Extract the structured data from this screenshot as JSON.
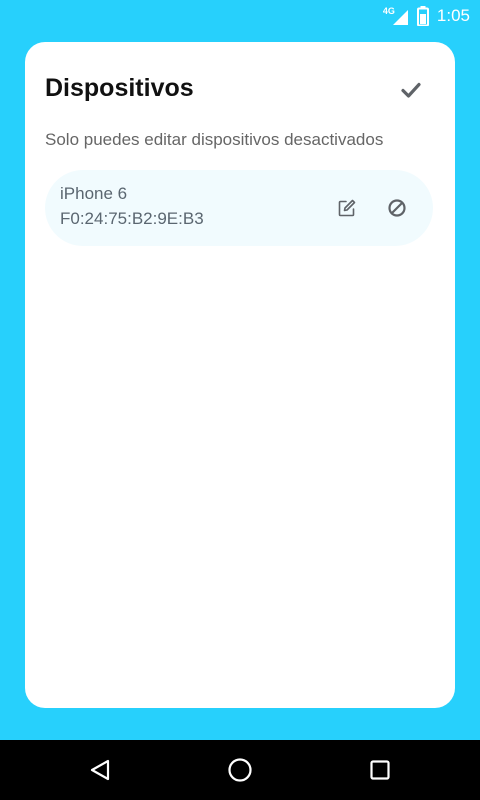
{
  "status_bar": {
    "network_label": "4G",
    "time": "1:05",
    "icons": [
      "signal-icon",
      "battery-icon"
    ]
  },
  "card": {
    "title": "Dispositivos",
    "subtitle": "Solo puedes editar dispositivos desactivados",
    "confirm_icon": "check-icon"
  },
  "devices": [
    {
      "name": "iPhone 6",
      "mac": "F0:24:75:B2:9E:B3",
      "edit_icon": "edit-icon",
      "deactivate_icon": "block-icon"
    }
  ],
  "nav_bar": {
    "icons": [
      "back-icon",
      "home-icon",
      "recents-icon"
    ]
  },
  "colors": {
    "background": "#27d0fc",
    "card": "#ffffff",
    "device_item": "#f1fbfe",
    "icon": "#5f6368"
  }
}
